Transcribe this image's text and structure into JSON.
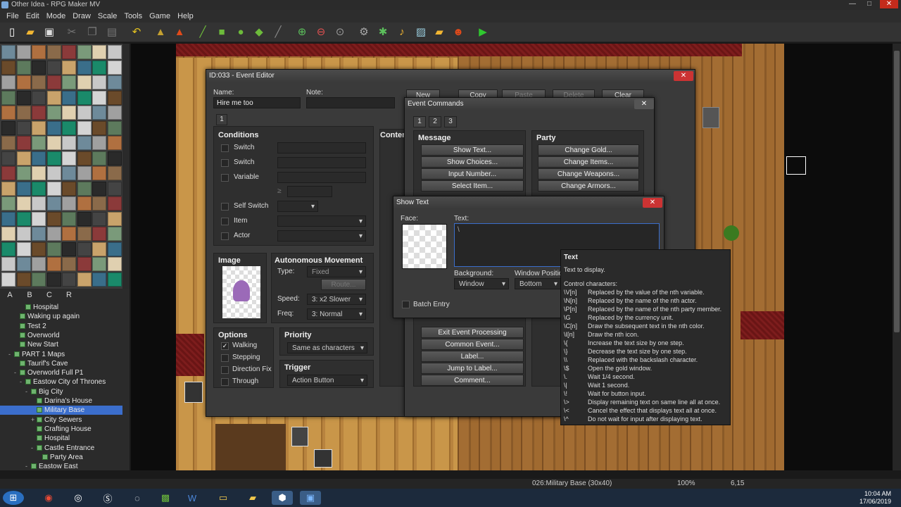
{
  "window": {
    "title": "Other Idea - RPG Maker MV",
    "minimize": "—",
    "maximize": "□",
    "close": "✕"
  },
  "menubar": [
    "File",
    "Edit",
    "Mode",
    "Draw",
    "Scale",
    "Tools",
    "Game",
    "Help"
  ],
  "toolbar_icons": [
    "new-icon",
    "open-icon",
    "save-icon",
    "cut-icon",
    "copy-icon",
    "paste-icon",
    "undo-icon",
    "map-mode-icon",
    "event-mode-icon",
    "pencil-icon",
    "rectangle-icon",
    "ellipse-icon",
    "fill-icon",
    "shadow-pen-icon",
    "zoom-in-icon",
    "zoom-out-icon",
    "zoom-reset-icon",
    "database-icon",
    "plugin-icon",
    "sound-icon",
    "character-gen-icon",
    "resource-manager-icon",
    "event-search-icon",
    "playtest-icon"
  ],
  "palette_tabs": [
    "A",
    "B",
    "C",
    "R"
  ],
  "map_tree": [
    {
      "label": "Hospital",
      "depth": 3,
      "exp": ""
    },
    {
      "label": "Waking up again",
      "depth": 2,
      "exp": ""
    },
    {
      "label": "Test 2",
      "depth": 2,
      "exp": ""
    },
    {
      "label": "Overworld",
      "depth": 2,
      "exp": ""
    },
    {
      "label": "New Start",
      "depth": 2,
      "exp": ""
    },
    {
      "label": "PART 1 Maps",
      "depth": 1,
      "exp": "-"
    },
    {
      "label": "Taurif's Cave",
      "depth": 2,
      "exp": ""
    },
    {
      "label": "Overworld Full P1",
      "depth": 2,
      "exp": "-"
    },
    {
      "label": "Eastow City of Thrones",
      "depth": 3,
      "exp": "-"
    },
    {
      "label": "Big City",
      "depth": 4,
      "exp": "-"
    },
    {
      "label": "Darina's House",
      "depth": 5,
      "exp": ""
    },
    {
      "label": "Military Base",
      "depth": 5,
      "exp": "",
      "selected": true
    },
    {
      "label": "City Sewers",
      "depth": 5,
      "exp": "+"
    },
    {
      "label": "Crafting House",
      "depth": 5,
      "exp": ""
    },
    {
      "label": "Hospital",
      "depth": 5,
      "exp": ""
    },
    {
      "label": "Castle Entrance",
      "depth": 5,
      "exp": "-"
    },
    {
      "label": "Party Area",
      "depth": 6,
      "exp": ""
    },
    {
      "label": "Eastow East",
      "depth": 4,
      "exp": "-"
    }
  ],
  "event_editor": {
    "title": "ID:033 - Event Editor",
    "name_label": "Name:",
    "name_value": "Hire me too",
    "note_label": "Note:",
    "note_value": "",
    "buttons": {
      "new": "New",
      "copy": "Copy",
      "paste": "Paste",
      "delete": "Delete",
      "clear": "Clear"
    },
    "page_tab": "1",
    "conditions_title": "Conditions",
    "conditions": [
      "Switch",
      "Switch",
      "Variable"
    ],
    "variable_op": "≥",
    "self_switch": "Self Switch",
    "item": "Item",
    "actor": "Actor",
    "image_title": "Image",
    "autonomous_title": "Autonomous Movement",
    "type_label": "Type:",
    "type_value": "Fixed",
    "route_button": "Route...",
    "speed_label": "Speed:",
    "speed_value": "3: x2 Slower",
    "freq_label": "Freq:",
    "freq_value": "3: Normal",
    "options_title": "Options",
    "options": [
      {
        "label": "Walking",
        "checked": "✓"
      },
      {
        "label": "Stepping",
        "checked": ""
      },
      {
        "label": "Direction Fix",
        "checked": ""
      },
      {
        "label": "Through",
        "checked": ""
      }
    ],
    "priority_title": "Priority",
    "priority_value": "Same as characters",
    "trigger_title": "Trigger",
    "trigger_value": "Action Button",
    "contents_title": "Content"
  },
  "event_commands": {
    "title": "Event Commands",
    "tabs": [
      "1",
      "2",
      "3"
    ],
    "message_title": "Message",
    "message_buttons": [
      "Show Text...",
      "Show Choices...",
      "Input Number...",
      "Select Item..."
    ],
    "party_title": "Party",
    "party_buttons": [
      "Change Gold...",
      "Change Items...",
      "Change Weapons...",
      "Change Armors..."
    ],
    "flow_buttons": [
      "Exit Event Processing",
      "Common Event...",
      "Label...",
      "Jump to Label...",
      "Comment..."
    ]
  },
  "show_text": {
    "title": "Show Text",
    "face_label": "Face:",
    "text_label": "Text:",
    "text_value": "\\",
    "background_label": "Background:",
    "background_value": "Window",
    "position_label": "Window Positio",
    "position_value": "Bottom",
    "batch_entry": "Batch Entry"
  },
  "tooltip": {
    "title": "Text",
    "description": "Text to display.",
    "heading": "Control characters:",
    "codes": [
      {
        "code": "\\V[n]",
        "desc": "Replaced by the value of the nth variable."
      },
      {
        "code": "\\N[n]",
        "desc": "Replaced by the name of the nth actor."
      },
      {
        "code": "\\P[n]",
        "desc": "Replaced by the name of the nth party member."
      },
      {
        "code": "\\G",
        "desc": "Replaced by the currency unit."
      },
      {
        "code": "\\C[n]",
        "desc": "Draw the subsequent text in the nth color."
      },
      {
        "code": "\\I[n]",
        "desc": "Draw the nth icon."
      },
      {
        "code": "\\{",
        "desc": "Increase the text size by one step."
      },
      {
        "code": "\\}",
        "desc": "Decrease the text size by one step."
      },
      {
        "code": "\\\\",
        "desc": "Replaced with the backslash character."
      },
      {
        "code": "\\$",
        "desc": "Open the gold window."
      },
      {
        "code": "\\.",
        "desc": "Wait 1/4 second."
      },
      {
        "code": "\\|",
        "desc": "Wait 1 second."
      },
      {
        "code": "\\!",
        "desc": "Wait for button input."
      },
      {
        "code": "\\>",
        "desc": "Display remaining text on same line all at once."
      },
      {
        "code": "\\<",
        "desc": "Cancel the effect that displays text all at once."
      },
      {
        "code": "\\^",
        "desc": "Do not wait for input after displaying text."
      }
    ]
  },
  "statusbar": {
    "map": "026:Military Base (30x40)",
    "zoom": "100%",
    "coords": "6,15"
  },
  "taskbar": {
    "time": "10:04 AM",
    "date": "17/06/2019",
    "apps": [
      "start-icon",
      "chrome-icon",
      "steam-icon",
      "skype-icon",
      "app-icon",
      "excel-icon",
      "word-icon",
      "explorer-icon",
      "folder-icon",
      "rpgmaker-icon",
      "vscode-icon"
    ]
  }
}
